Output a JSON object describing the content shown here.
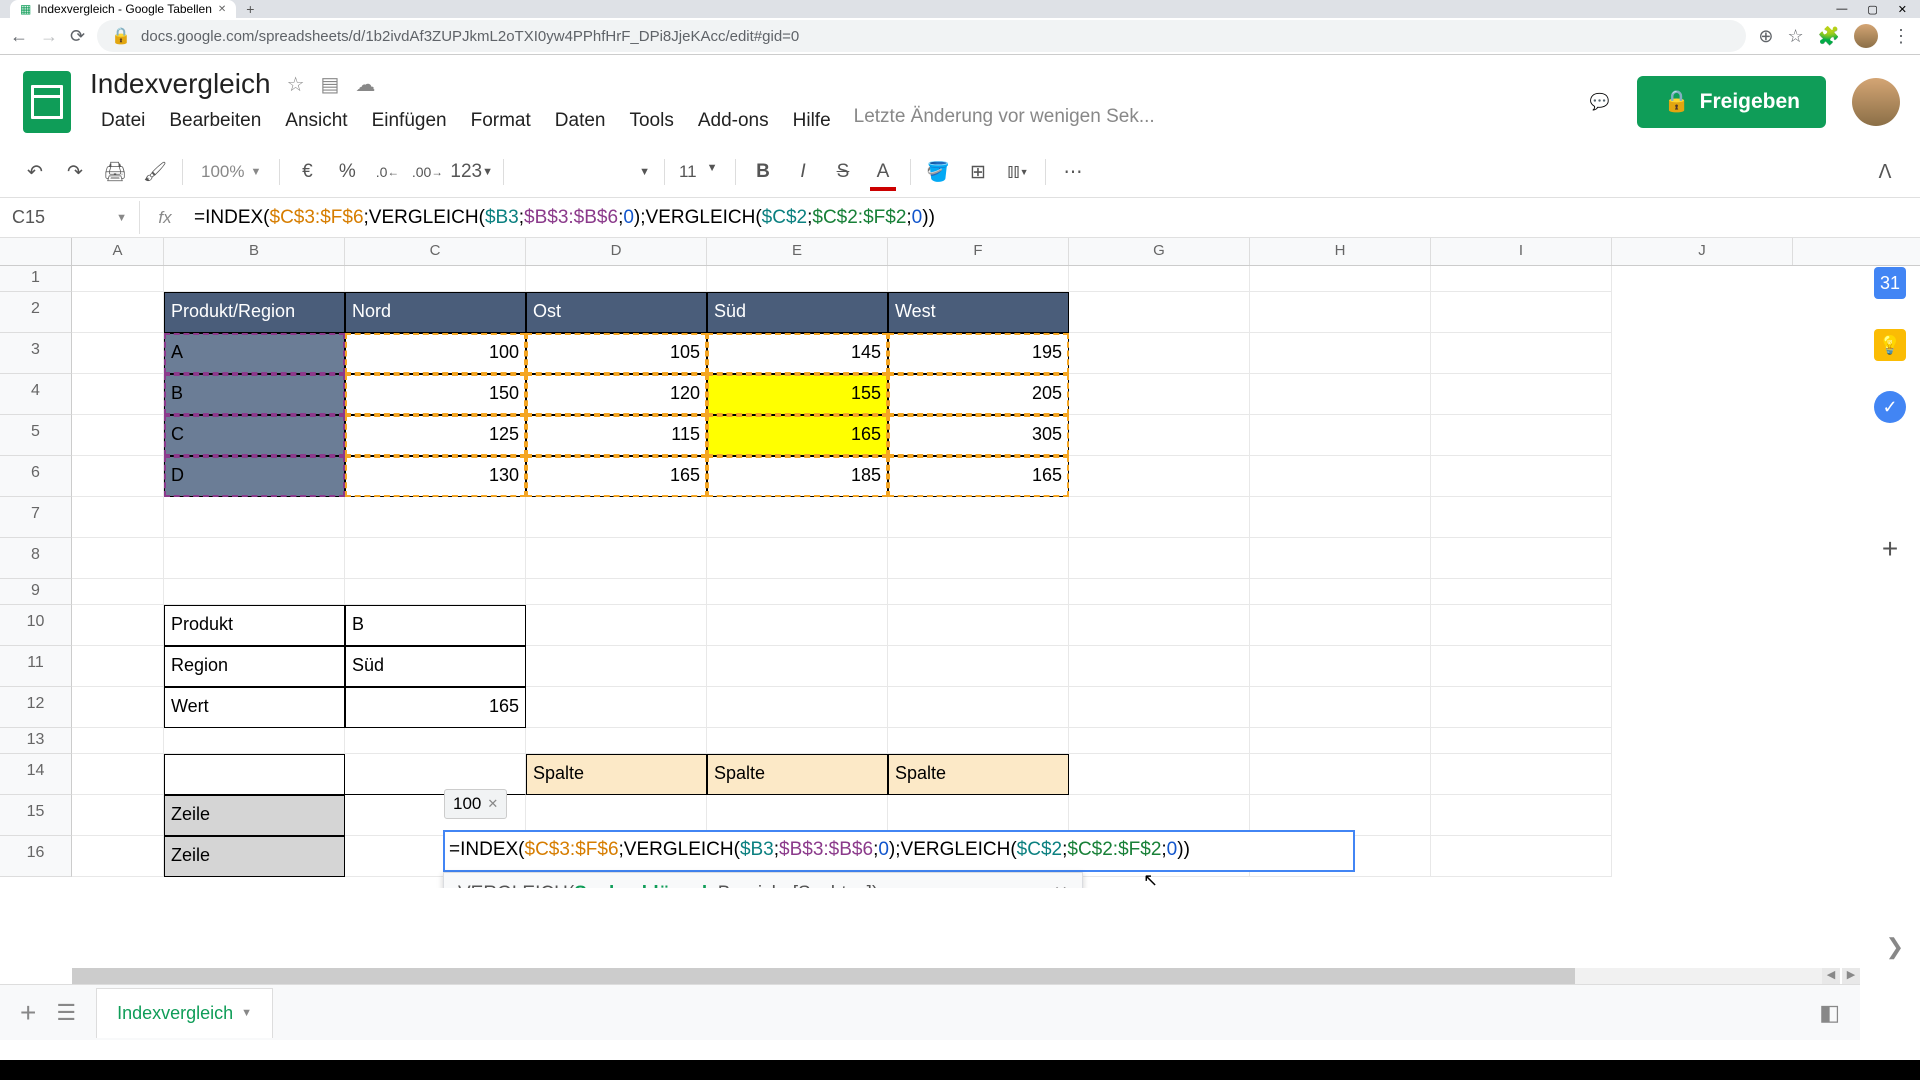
{
  "browser": {
    "tab_title": "Indexvergleich - Google Tabellen",
    "url": "docs.google.com/spreadsheets/d/1b2ivdAf3ZUPJkmL2oTXI0yw4PPhfHrF_DPi8JjeKAcc/edit#gid=0"
  },
  "doc": {
    "title": "Indexvergleich",
    "share_label": "Freigeben",
    "last_edit": "Letzte Änderung vor wenigen Sek..."
  },
  "menu": {
    "file": "Datei",
    "edit": "Bearbeiten",
    "view": "Ansicht",
    "insert": "Einfügen",
    "format": "Format",
    "data": "Daten",
    "tools": "Tools",
    "addons": "Add-ons",
    "help": "Hilfe"
  },
  "toolbar": {
    "zoom": "100%",
    "currency": "€",
    "percent": "%",
    "dec_less": ".0",
    "dec_more": ".00",
    "format_num": "123",
    "font_size": "11"
  },
  "formula_bar": {
    "cell_ref": "C15",
    "parts": [
      {
        "t": "=INDEX(",
        "c": "black"
      },
      {
        "t": "$C$3:$F$6",
        "c": "orange"
      },
      {
        "t": ";",
        "c": "black"
      },
      {
        "t": "VERGLEICH(",
        "c": "black"
      },
      {
        "t": "$B3",
        "c": "teal"
      },
      {
        "t": ";",
        "c": "black"
      },
      {
        "t": "$B$3:$B$6",
        "c": "purple"
      },
      {
        "t": ";",
        "c": "black"
      },
      {
        "t": "0",
        "c": "blue"
      },
      {
        "t": ");",
        "c": "black"
      },
      {
        "t": "VERGLEICH(",
        "c": "black"
      },
      {
        "t": "$C$2",
        "c": "teal"
      },
      {
        "t": ";",
        "c": "black"
      },
      {
        "t": "$C$2:$F$2",
        "c": "green"
      },
      {
        "t": ";",
        "c": "black"
      },
      {
        "t": "0",
        "c": "blue"
      },
      {
        "t": "))",
        "c": "black"
      }
    ]
  },
  "columns": [
    "A",
    "B",
    "C",
    "D",
    "E",
    "F",
    "G",
    "H",
    "I",
    "J"
  ],
  "rows": [
    "1",
    "2",
    "3",
    "4",
    "5",
    "6",
    "7",
    "8",
    "9",
    "10",
    "11",
    "12",
    "13",
    "14",
    "15",
    "16"
  ],
  "table1": {
    "header": [
      "Produkt/Region",
      "Nord",
      "Ost",
      "Süd",
      "West"
    ],
    "rows": [
      {
        "label": "A",
        "vals": [
          "100",
          "105",
          "145",
          "195"
        ]
      },
      {
        "label": "B",
        "vals": [
          "150",
          "120",
          "155",
          "205"
        ]
      },
      {
        "label": "C",
        "vals": [
          "125",
          "115",
          "165",
          "305"
        ]
      },
      {
        "label": "D",
        "vals": [
          "130",
          "165",
          "185",
          "165"
        ]
      }
    ]
  },
  "lookup": {
    "produkt_lbl": "Produkt",
    "produkt_val": "B",
    "region_lbl": "Region",
    "region_val": "Süd",
    "wert_lbl": "Wert",
    "wert_val": "165"
  },
  "table2": {
    "spalte": "Spalte",
    "zeile": "Zeile"
  },
  "inline_formula": {
    "preview": "100",
    "parts": [
      {
        "t": "=INDEX(",
        "c": "black"
      },
      {
        "t": "$C$3:$F$6",
        "c": "orange"
      },
      {
        "t": ";",
        "c": "black"
      },
      {
        "t": "VERGLEICH(",
        "c": "black"
      },
      {
        "t": "$B3",
        "c": "teal"
      },
      {
        "t": ";",
        "c": "black"
      },
      {
        "t": "$B$3:$B$6",
        "c": "purple"
      },
      {
        "t": ";",
        "c": "black"
      },
      {
        "t": "0",
        "c": "blue"
      },
      {
        "t": ");",
        "c": "black"
      },
      {
        "t": "VERGLEICH(",
        "c": "black"
      },
      {
        "t": "$C$2",
        "c": "teal"
      },
      {
        "t": ";",
        "c": "black"
      },
      {
        "t": "$C$2:$F$2",
        "c": "green"
      },
      {
        "t": ";",
        "c": "black"
      },
      {
        "t": "0",
        "c": "blue"
      },
      {
        "t": "))",
        "c": "black"
      }
    ]
  },
  "tooltip": {
    "fn": "VERGLEICH(",
    "arg1": "Suchschlüssel",
    "rest": "; Bereich; [Suchtyp])"
  },
  "sheet_tab": "Indexvergleich"
}
